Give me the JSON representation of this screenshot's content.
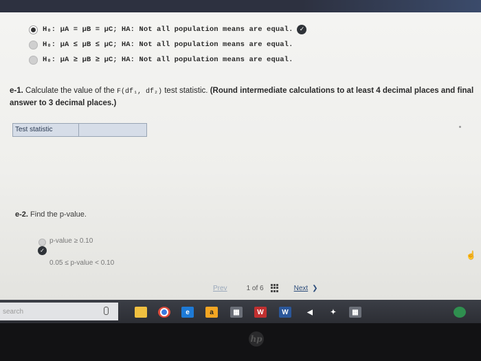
{
  "hypotheses": [
    {
      "h0": "H₀: μA = μB = μC;",
      "ha": "HA: Not all population means are equal.",
      "selected": true,
      "correct": true
    },
    {
      "h0": "H₀: μA ≤ μB ≤ μC;",
      "ha": "HA: Not all population means are equal.",
      "selected": false,
      "correct": false
    },
    {
      "h0": "H₀: μA ≥ μB ≥ μC;",
      "ha": "HA: Not all population means are equal.",
      "selected": false,
      "correct": false
    }
  ],
  "question_e1": {
    "number": "e-1.",
    "text_before": "Calculate the value of the ",
    "f_symbol": "F(df₁, df₂)",
    "text_after": " test statistic. ",
    "instruction": "(Round intermediate calculations to at least 4 decimal places and final answer to 3 decimal places.)",
    "input_label": "Test statistic",
    "input_value": ""
  },
  "question_e2": {
    "number": "e-2.",
    "text": "Find the p-value.",
    "options": [
      {
        "label": "p-value ≥ 0.10",
        "correct": false
      },
      {
        "label": "0.05 ≤ p-value < 0.10",
        "correct": true
      }
    ]
  },
  "pagination": {
    "prev": "Prev",
    "current": "1",
    "of": "of",
    "total": "6",
    "next": "Next"
  },
  "taskbar": {
    "search_placeholder": "search",
    "icons": [
      "file-explorer-icon",
      "chrome-icon",
      "edge-icon",
      "amazon-icon",
      "store-icon",
      "word-icon",
      "word-alt-icon",
      "mail-icon",
      "dropbox-icon",
      "calculator-icon",
      "chrome-tray-icon"
    ]
  },
  "brand": "hp"
}
